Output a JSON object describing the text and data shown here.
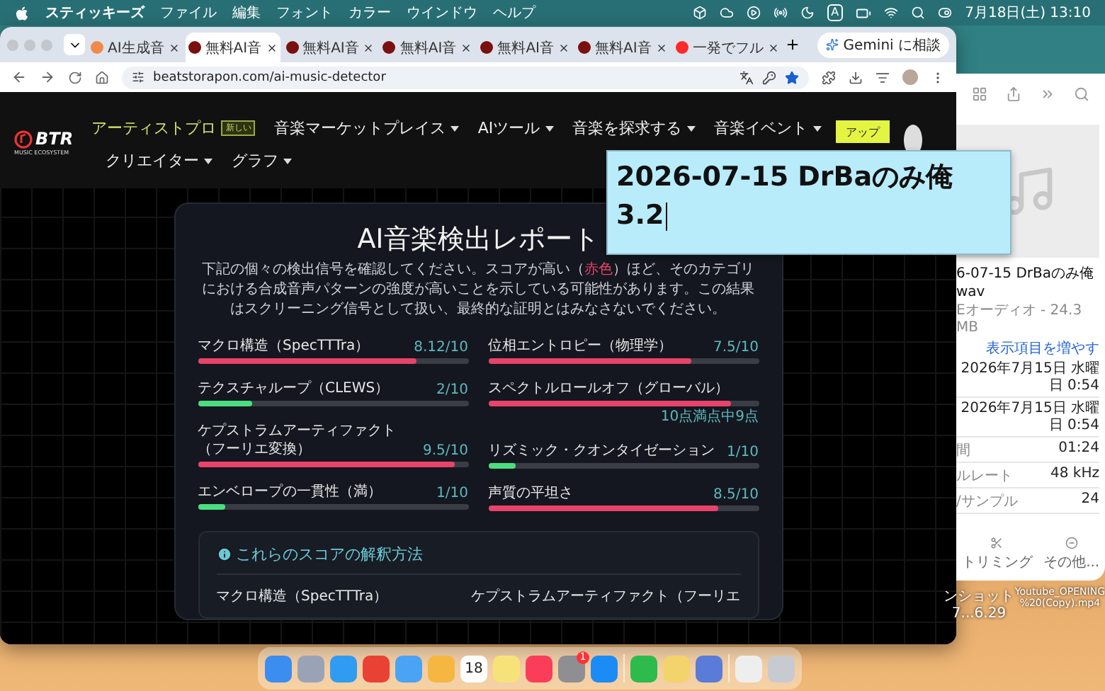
{
  "menu_bar": {
    "app_name": "スティッキーズ",
    "menus": [
      "ファイル",
      "編集",
      "フォント",
      "カラー",
      "ウインドウ",
      "ヘルプ"
    ],
    "input_source": "A",
    "clock": "7月18日(土) 13:10"
  },
  "browser": {
    "tabs": [
      {
        "label": "AI生成音",
        "selected": false,
        "kind": "sun"
      },
      {
        "label": "無料AI音",
        "selected": true,
        "kind": "site"
      },
      {
        "label": "無料AI音",
        "selected": false,
        "kind": "site"
      },
      {
        "label": "無料AI音",
        "selected": false,
        "kind": "site"
      },
      {
        "label": "無料AI音",
        "selected": false,
        "kind": "site"
      },
      {
        "label": "無料AI音",
        "selected": false,
        "kind": "site"
      },
      {
        "label": "一発でフル",
        "selected": false,
        "kind": "video"
      }
    ],
    "assistant_button": "Gemini に相談",
    "url": "beatstorapon.com/ai-music-detector"
  },
  "site_nav": {
    "logo": "BTR",
    "logo_tagline": "MUSIC ECOSYSTEM",
    "rows": [
      [
        {
          "label": "アーティストプロ",
          "badge": "新しい",
          "dropdown": false,
          "highlighted": true
        },
        {
          "label": "音楽マーケットプレイス",
          "dropdown": true,
          "highlighted": false
        },
        {
          "label": "AIツール",
          "dropdown": true,
          "highlighted": false
        },
        {
          "label": "音楽を探求する",
          "dropdown": true,
          "highlighted": false
        },
        {
          "label": "音楽イベント",
          "dropdown": true,
          "highlighted": false
        }
      ],
      [
        {
          "label": "クリエイター",
          "dropdown": true,
          "highlighted": false
        },
        {
          "label": "グラフ",
          "dropdown": true,
          "highlighted": false
        }
      ]
    ],
    "upload_button": "アップ"
  },
  "report": {
    "title": "AI音楽検出レポート",
    "description": {
      "before": "下記の個々の検出信号を確認してください。スコアが高い（",
      "highlight": "赤色",
      "after": "）ほど、そのカテゴリにおける合成音声パターンの強度が高いことを示している可能性があります。この結果はスクリーニング信号として扱い、最終的な証明とはみなさないでください。"
    },
    "metric_columns": [
      [
        {
          "label": "マクロ構造（SpecTTTra）",
          "score": "8.12/10",
          "level": 0.81,
          "color": "#e8436a"
        },
        {
          "label": "テクスチャループ（CLEWS）",
          "score": "2/10",
          "level": 0.2,
          "color": "#4ade80"
        },
        {
          "label": "ケプストラムアーティファクト（フーリエ変換）",
          "score": "9.5/10",
          "level": 0.95,
          "color": "#e8436a"
        },
        {
          "label": "エンベロープの一貫性（満）",
          "score": "1/10",
          "level": 0.1,
          "color": "#4ade80"
        }
      ],
      [
        {
          "label": "位相エントロピー（物理学）",
          "score": "7.5/10",
          "level": 0.75,
          "color": "#e8436a"
        },
        {
          "label": "スペクトルロールオフ（グローバル）",
          "note": "10点満点中9点",
          "level": 0.9,
          "color": "#e8436a"
        },
        {
          "label": "リズミック・クオンタイゼーション",
          "score": "1/10",
          "level": 0.1,
          "color": "#4ade80"
        },
        {
          "label": "声質の平坦さ",
          "score": "8.5/10",
          "level": 0.85,
          "color": "#e8436a"
        }
      ]
    ],
    "interpretation": {
      "title": "これらのスコアの解釈方法",
      "items": [
        "マクロ構造（SpecTTTra）",
        "ケプストラムアーティファクト（フーリエ"
      ]
    }
  },
  "sticky_note": {
    "lines": [
      "2026-07-15 DrBaのみ俺",
      "3.2"
    ]
  },
  "preview": {
    "title_lines": [
      "6-07-15 DrBaのみ俺",
      "wav"
    ],
    "subtitle": "Eオーディオ - 24.3 MB",
    "more_link": "表示項目を増やす",
    "rows": [
      {
        "value": "2026年7月15日 水曜日 0:54"
      },
      {
        "value": "2026年7月15日 水曜日 0:54"
      },
      {
        "label": "間",
        "value": "01:24"
      },
      {
        "label": "ルレート",
        "value": "48 kHz"
      },
      {
        "label": "/サンプル",
        "value": "24"
      }
    ],
    "actions": [
      {
        "kind": "trim",
        "label": "トリミング"
      },
      {
        "kind": "more",
        "label": "その他..."
      }
    ]
  },
  "desktop_files": [
    {
      "lines": [
        "ンショット",
        "7...6.29"
      ]
    },
    {
      "lines": [
        "Youtube_OPENING",
        "%20(Copy).mp4"
      ]
    }
  ],
  "dock": {
    "apps": [
      {
        "kind": "app",
        "color": "#3b8df0"
      },
      {
        "kind": "app",
        "color": "#9aa3b5"
      },
      {
        "kind": "app",
        "color": "#2f9cf2"
      },
      {
        "kind": "app",
        "color": "#e94235"
      },
      {
        "kind": "app",
        "color": "#4aa3f5"
      },
      {
        "kind": "app",
        "color": "#f5b642"
      },
      {
        "kind": "calendar",
        "day": "18"
      },
      {
        "kind": "app",
        "color": "#f7e27a"
      },
      {
        "kind": "app",
        "color": "#fa3e5a"
      },
      {
        "kind": "app",
        "color": "#8e8e93",
        "badge": "1"
      },
      {
        "kind": "app",
        "color": "#1b8cf5"
      },
      {
        "kind": "separator"
      },
      {
        "kind": "app",
        "color": "#2dbb4e"
      },
      {
        "kind": "app",
        "color": "#f3d36b"
      },
      {
        "kind": "app",
        "color": "#5a7bd8"
      },
      {
        "kind": "separator"
      },
      {
        "kind": "app",
        "color": "#eeeeee"
      },
      {
        "kind": "app",
        "color": "#c7cbd1"
      }
    ]
  }
}
